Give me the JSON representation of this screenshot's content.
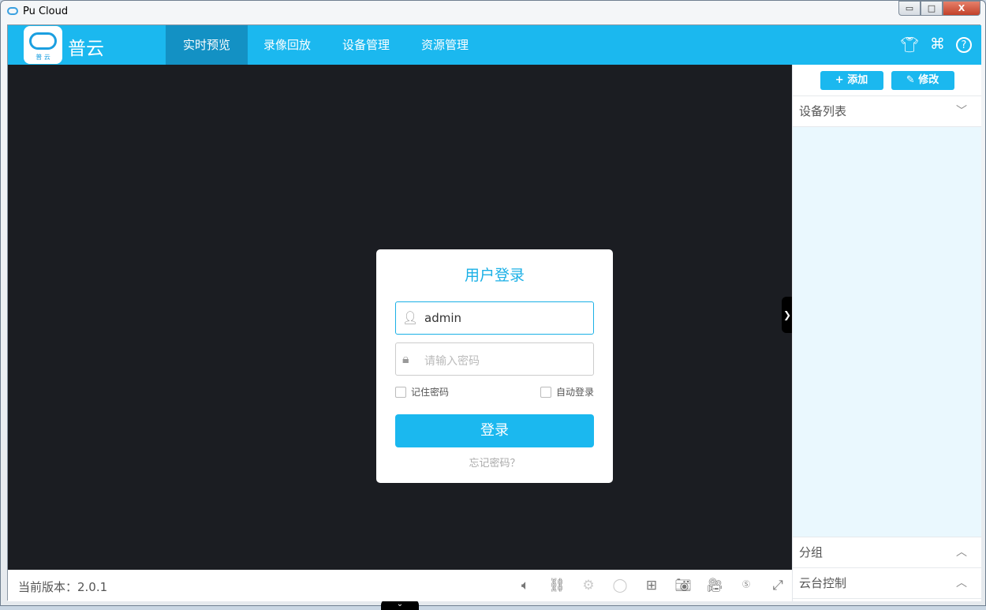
{
  "window": {
    "title": "Pu Cloud",
    "min": "▭",
    "max": "□",
    "close": "X"
  },
  "header": {
    "logo_text": "普 云",
    "brand": "普云",
    "nav": [
      "实时预览",
      "录像回放",
      "设备管理",
      "资源管理"
    ],
    "icons": [
      "shirt-icon",
      "command-icon",
      "help-icon"
    ]
  },
  "sidebar": {
    "add": "+ 添加",
    "edit": "✎ 修改",
    "device_list": "设备列表",
    "group": "分组",
    "ptz": "云台控制"
  },
  "login": {
    "title": "用户登录",
    "username": "admin",
    "password_placeholder": "请输入密码",
    "remember": "记住密码",
    "auto": "自动登录",
    "submit": "登录",
    "forgot": "忘记密码？"
  },
  "footer": {
    "version": "当前版本：2.0.1"
  },
  "colors": {
    "accent": "#1bb8ef",
    "nav_active": "#1391c4",
    "video_bg": "#1b1d22"
  }
}
